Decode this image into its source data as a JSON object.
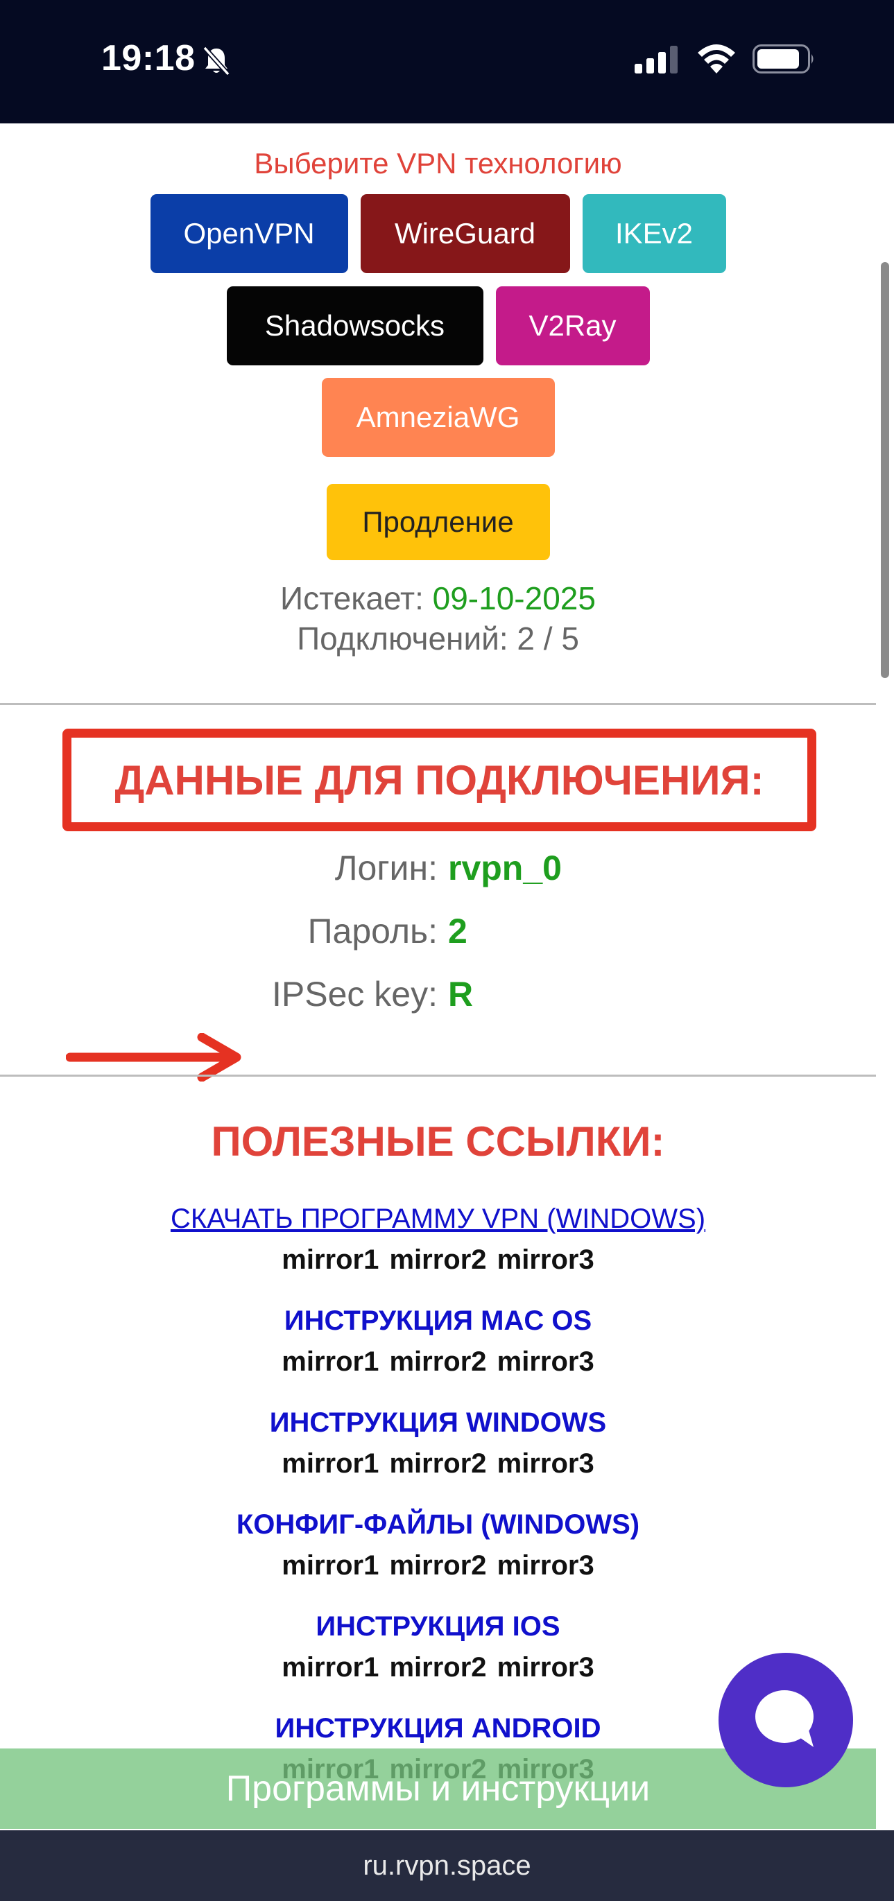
{
  "status_bar": {
    "time": "19:18",
    "icons": [
      "bell-slash-icon",
      "signal-icon",
      "wifi-icon",
      "battery-icon"
    ]
  },
  "vpn": {
    "title": "Выберите VPN технологию",
    "buttons": [
      {
        "label": "OpenVPN",
        "color": "#0b3ea8"
      },
      {
        "label": "WireGuard",
        "color": "#861719"
      },
      {
        "label": "IKEv2",
        "color": "#32b9bd"
      },
      {
        "label": "Shadowsocks",
        "color": "#050505"
      },
      {
        "label": "V2Ray",
        "color": "#c41b8a"
      },
      {
        "label": "AmneziaWG",
        "color": "#ff8452"
      }
    ],
    "renew": {
      "label": "Продление",
      "color": "#ffc20a"
    }
  },
  "subscription": {
    "expires_label": "Истекает:",
    "expires_value": "09-10-2025",
    "connections_label": "Подключений:",
    "connections_value": "2 / 5"
  },
  "connection": {
    "title": "ДАННЫЕ ДЛЯ ПОДКЛЮЧЕНИЯ:",
    "login_label": "Логин:",
    "login_value": "rvpn_0",
    "password_label": "Пароль:",
    "password_value": "2",
    "ipsec_label": "IPSec key:",
    "ipsec_value": "R"
  },
  "links": {
    "title": "ПОЛЕЗНЫЕ ССЫЛКИ:",
    "items": [
      {
        "label": "СКАЧАТЬ ПРОГРАММУ VPN (WINDOWS)",
        "mirrors": [
          "mirror1",
          "mirror2",
          "mirror3"
        ]
      },
      {
        "label": "ИНСТРУКЦИЯ MAC OS",
        "mirrors": [
          "mirror1",
          "mirror2",
          "mirror3"
        ]
      },
      {
        "label": "ИНСТРУКЦИЯ WINDOWS",
        "mirrors": [
          "mirror1",
          "mirror2",
          "mirror3"
        ]
      },
      {
        "label": "КОНФИГ-ФАЙЛЫ (WINDOWS)",
        "mirrors": [
          "mirror1",
          "mirror2",
          "mirror3"
        ]
      },
      {
        "label": "ИНСТРУКЦИЯ IOS",
        "mirrors": [
          "mirror1",
          "mirror2",
          "mirror3"
        ]
      },
      {
        "label": "ИНСТРУКЦИЯ ANDROID",
        "mirrors": [
          "mirror1",
          "mirror2",
          "mirror3"
        ]
      }
    ]
  },
  "banner": {
    "label": "Программы и инструкции"
  },
  "browser": {
    "address": "ru.rvpn.space"
  }
}
